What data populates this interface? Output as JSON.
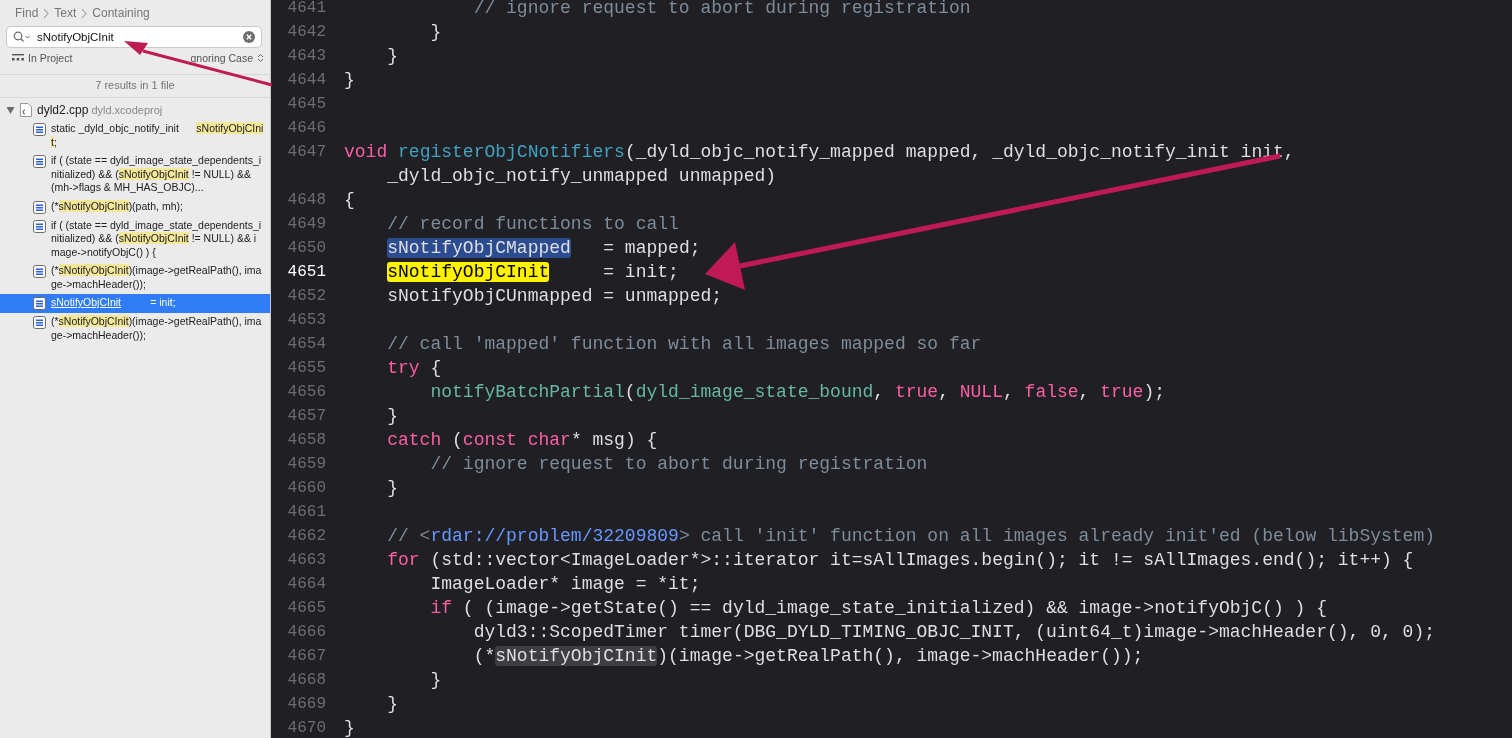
{
  "find_navigator": {
    "breadcrumb": [
      "Find",
      "Text",
      "Containing"
    ],
    "search": {
      "value": "sNotifyObjCInit"
    },
    "scope": "In Project",
    "case_mode": "gnoring Case",
    "summary": "7 results in 1 file",
    "file": {
      "name": "dyld2.cpp",
      "project": "dyld.xcodeproj",
      "expanded": true,
      "results": [
        {
          "selected": false,
          "parts": [
            {
              "t": "static _dyld_objc_notify_init      ",
              "match": false
            },
            {
              "t": "sNotifyObjCInit",
              "match": true
            },
            {
              "t": ";",
              "match": false
            }
          ]
        },
        {
          "selected": false,
          "parts": [
            {
              "t": "if ( (state == dyld_image_state_dependents_initialized) && (",
              "match": false
            },
            {
              "t": "sNotifyObjCInit",
              "match": true
            },
            {
              "t": " != NULL) && (mh->flags & MH_HAS_OBJC)...",
              "match": false
            }
          ]
        },
        {
          "selected": false,
          "parts": [
            {
              "t": "(*",
              "match": false
            },
            {
              "t": "sNotifyObjCInit",
              "match": true
            },
            {
              "t": ")(path, mh);",
              "match": false
            }
          ]
        },
        {
          "selected": false,
          "parts": [
            {
              "t": "if ( (state == dyld_image_state_dependents_initialized) && (",
              "match": false
            },
            {
              "t": "sNotifyObjCInit",
              "match": true
            },
            {
              "t": " != NULL) && image->notifyObjC() ) {",
              "match": false
            }
          ]
        },
        {
          "selected": false,
          "parts": [
            {
              "t": "(*",
              "match": false
            },
            {
              "t": "sNotifyObjCInit",
              "match": true
            },
            {
              "t": ")(image->getRealPath(), image->machHeader());",
              "match": false
            }
          ]
        },
        {
          "selected": true,
          "parts": [
            {
              "t": "sNotifyObjCInit",
              "match": true
            },
            {
              "t": "          = init;",
              "match": false
            }
          ]
        },
        {
          "selected": false,
          "parts": [
            {
              "t": "(*",
              "match": false
            },
            {
              "t": "sNotifyObjCInit",
              "match": true
            },
            {
              "t": ")(image->getRealPath(), image->machHeader());",
              "match": false
            }
          ]
        }
      ]
    }
  },
  "editor": {
    "lines": [
      {
        "number": "4641",
        "current": false,
        "tokens": [
          {
            "t": "            // ignore request to abort during registration",
            "kind": "comment"
          }
        ]
      },
      {
        "number": "4642",
        "current": false,
        "tokens": [
          {
            "t": "        }",
            "kind": "plain"
          }
        ]
      },
      {
        "number": "4643",
        "current": false,
        "tokens": [
          {
            "t": "    }",
            "kind": "plain"
          }
        ]
      },
      {
        "number": "4644",
        "current": false,
        "tokens": [
          {
            "t": "}",
            "kind": "plain"
          }
        ]
      },
      {
        "number": "4645",
        "current": false
      },
      {
        "number": "4646",
        "current": false
      },
      {
        "number": "4647",
        "current": false,
        "tokens": [
          {
            "t": "void",
            "kind": "keyword"
          },
          {
            "t": " registerObjCNotifiers",
            "kind": "decl"
          },
          {
            "t": "(_dyld_objc_notify_mapped mapped, _dyld_objc_notify_init init,",
            "kind": "plain"
          }
        ],
        "wrapped": [
          {
            "t": "    _dyld_objc_notify_unmapped unmapped)",
            "kind": "plain"
          }
        ]
      },
      {
        "number": "4648",
        "current": false,
        "tokens": [
          {
            "t": "{",
            "kind": "plain"
          }
        ]
      },
      {
        "number": "4649",
        "current": false,
        "tokens": [
          {
            "t": "    // record functions to call",
            "kind": "comment"
          }
        ]
      },
      {
        "number": "4650",
        "current": false,
        "tokens": [
          {
            "t": "    sNotifyObjCMapped",
            "kind": "selection"
          },
          {
            "t": "   = mapped;",
            "kind": "plain"
          }
        ]
      },
      {
        "number": "4651",
        "current": true,
        "tokens": [
          {
            "t": "    sNotifyObjCInit",
            "kind": "found"
          },
          {
            "t": "     = init;",
            "kind": "plain"
          }
        ]
      },
      {
        "number": "4652",
        "current": false,
        "tokens": [
          {
            "t": "    sNotifyObjCUnmapped = unmapped;",
            "kind": "plain"
          }
        ]
      },
      {
        "number": "4653",
        "current": false
      },
      {
        "number": "4654",
        "current": false,
        "tokens": [
          {
            "t": "    // call 'mapped' function with all images mapped so far",
            "kind": "comment"
          }
        ]
      },
      {
        "number": "4655",
        "current": false,
        "tokens": [
          {
            "t": "    try",
            "kind": "keyword"
          },
          {
            "t": " {",
            "kind": "plain"
          }
        ]
      },
      {
        "number": "4656",
        "current": false,
        "tokens": [
          {
            "t": "        notifyBatchPartial",
            "kind": "func"
          },
          {
            "t": "(",
            "kind": "plain"
          },
          {
            "t": "dyld_image_state_bound",
            "kind": "func"
          },
          {
            "t": ", ",
            "kind": "plain"
          },
          {
            "t": "true",
            "kind": "keyword"
          },
          {
            "t": ", ",
            "kind": "plain"
          },
          {
            "t": "NULL",
            "kind": "keyword"
          },
          {
            "t": ", ",
            "kind": "plain"
          },
          {
            "t": "false",
            "kind": "keyword"
          },
          {
            "t": ", ",
            "kind": "plain"
          },
          {
            "t": "true",
            "kind": "keyword"
          },
          {
            "t": ");",
            "kind": "plain"
          }
        ]
      },
      {
        "number": "4657",
        "current": false,
        "tokens": [
          {
            "t": "    }",
            "kind": "plain"
          }
        ]
      },
      {
        "number": "4658",
        "current": false,
        "tokens": [
          {
            "t": "    catch",
            "kind": "keyword"
          },
          {
            "t": " (",
            "kind": "plain"
          },
          {
            "t": "const",
            "kind": "keyword"
          },
          {
            "t": " char",
            "kind": "keyword"
          },
          {
            "t": "* msg) {",
            "kind": "plain"
          }
        ]
      },
      {
        "number": "4659",
        "current": false,
        "tokens": [
          {
            "t": "        // ignore request to abort during registration",
            "kind": "comment"
          }
        ]
      },
      {
        "number": "4660",
        "current": false,
        "tokens": [
          {
            "t": "    }",
            "kind": "plain"
          }
        ]
      },
      {
        "number": "4661",
        "current": false
      },
      {
        "number": "4662",
        "current": false,
        "tokens": [
          {
            "t": "    // <",
            "kind": "comment"
          },
          {
            "t": "rdar://problem/32209809",
            "kind": "link"
          },
          {
            "t": "> call 'init' function on all images already init'ed (below libSystem)",
            "kind": "comment"
          }
        ]
      },
      {
        "number": "4663",
        "current": false,
        "tokens": [
          {
            "t": "    for",
            "kind": "keyword"
          },
          {
            "t": " (std::vector<ImageLoader*>::iterator it=sAllImages.begin(); it != sAllImages.end(); it++) {",
            "kind": "plain"
          }
        ]
      },
      {
        "number": "4664",
        "current": false,
        "tokens": [
          {
            "t": "        ImageLoader* image = *it;",
            "kind": "plain"
          }
        ]
      },
      {
        "number": "4665",
        "current": false,
        "tokens": [
          {
            "t": "        if",
            "kind": "keyword"
          },
          {
            "t": " ( (image->getState() == dyld_image_state_initialized) && image->notifyObjC() ) {",
            "kind": "plain"
          }
        ]
      },
      {
        "number": "4666",
        "current": false,
        "tokens": [
          {
            "t": "            dyld3::ScopedTimer timer(DBG_DYLD_TIMING_OBJC_INIT, (uint64_t)image->machHeader(), 0, 0);",
            "kind": "plain"
          }
        ]
      },
      {
        "number": "4667",
        "current": false,
        "tokens": [
          {
            "t": "            (*",
            "kind": "plain"
          },
          {
            "t": "sNotifyObjCInit",
            "kind": "occurrence"
          },
          {
            "t": ")(image->getRealPath(), image->machHeader());",
            "kind": "plain"
          }
        ]
      },
      {
        "number": "4668",
        "current": false,
        "tokens": [
          {
            "t": "        }",
            "kind": "plain"
          }
        ]
      },
      {
        "number": "4669",
        "current": false,
        "tokens": [
          {
            "t": "    }",
            "kind": "plain"
          }
        ]
      },
      {
        "number": "4670",
        "current": false,
        "tokens": [
          {
            "t": "}",
            "kind": "plain"
          }
        ]
      }
    ]
  }
}
